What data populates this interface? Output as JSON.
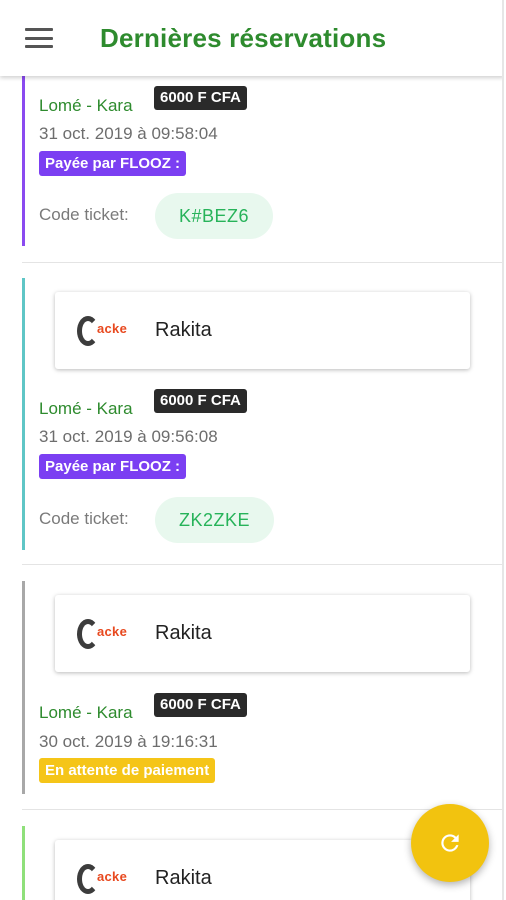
{
  "header": {
    "title": "Dernières réservations",
    "menu_icon": "menu-icon"
  },
  "colors": {
    "title_green": "#2e8b2e",
    "price_badge": "#2a2a2a",
    "paid_badge": "#7b3ff2",
    "pending_badge": "#f5c518",
    "code_chip_bg": "#e8f8ee",
    "code_chip_text": "#27b35a",
    "fab": "#f2c30f"
  },
  "reservations": [
    {
      "route": "Lomé - Kara",
      "price": "6000 F CFA",
      "date": "31 oct. 2019 à 09:58:04",
      "status": "Payée par FLOOZ :",
      "code_label": "Code ticket:",
      "code": "K#BEZ6",
      "accent": "#8a4af0"
    },
    {
      "company": "Rakita",
      "logo_text": "acke",
      "route": "Lomé - Kara",
      "price": "6000 F CFA",
      "date": "31 oct. 2019 à 09:56:08",
      "status": "Payée par FLOOZ :",
      "code_label": "Code ticket:",
      "code": "ZK2ZKE",
      "accent": "#5fc6c6"
    },
    {
      "company": "Rakita",
      "logo_text": "acke",
      "route": "Lomé - Kara",
      "price": "6000 F CFA",
      "date": "30 oct. 2019 à 19:16:31",
      "status": "En attente de paiement",
      "accent": "#a8a8a8"
    },
    {
      "company": "Rakita",
      "logo_text": "acke",
      "accent": "#8fe07a"
    }
  ],
  "fab": {
    "icon": "refresh-icon"
  }
}
